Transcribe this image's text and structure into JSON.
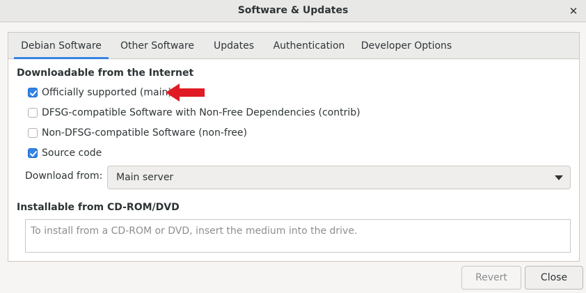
{
  "window": {
    "title": "Software & Updates"
  },
  "tabs": [
    {
      "label": "Debian Software",
      "active": true
    },
    {
      "label": "Other Software",
      "active": false
    },
    {
      "label": "Updates",
      "active": false
    },
    {
      "label": "Authentication",
      "active": false
    },
    {
      "label": "Developer Options",
      "active": false
    }
  ],
  "internet": {
    "heading": "Downloadable from the Internet",
    "options": [
      {
        "label": "Officially supported (main)",
        "checked": true
      },
      {
        "label": "DFSG-compatible Software with Non-Free Dependencies (contrib)",
        "checked": false
      },
      {
        "label": "Non-DFSG-compatible Software (non-free)",
        "checked": false
      },
      {
        "label": "Source code",
        "checked": true
      }
    ],
    "download_from_label": "Download from:",
    "download_from_value": "Main server"
  },
  "cdrom": {
    "heading": "Installable from CD-ROM/DVD",
    "placeholder": "To install from a CD-ROM or DVD, insert the medium into the drive."
  },
  "buttons": {
    "revert": "Revert",
    "close": "Close"
  },
  "annotation": {
    "arrow_color": "#e01b24"
  },
  "colors": {
    "accent": "#3584e4"
  }
}
